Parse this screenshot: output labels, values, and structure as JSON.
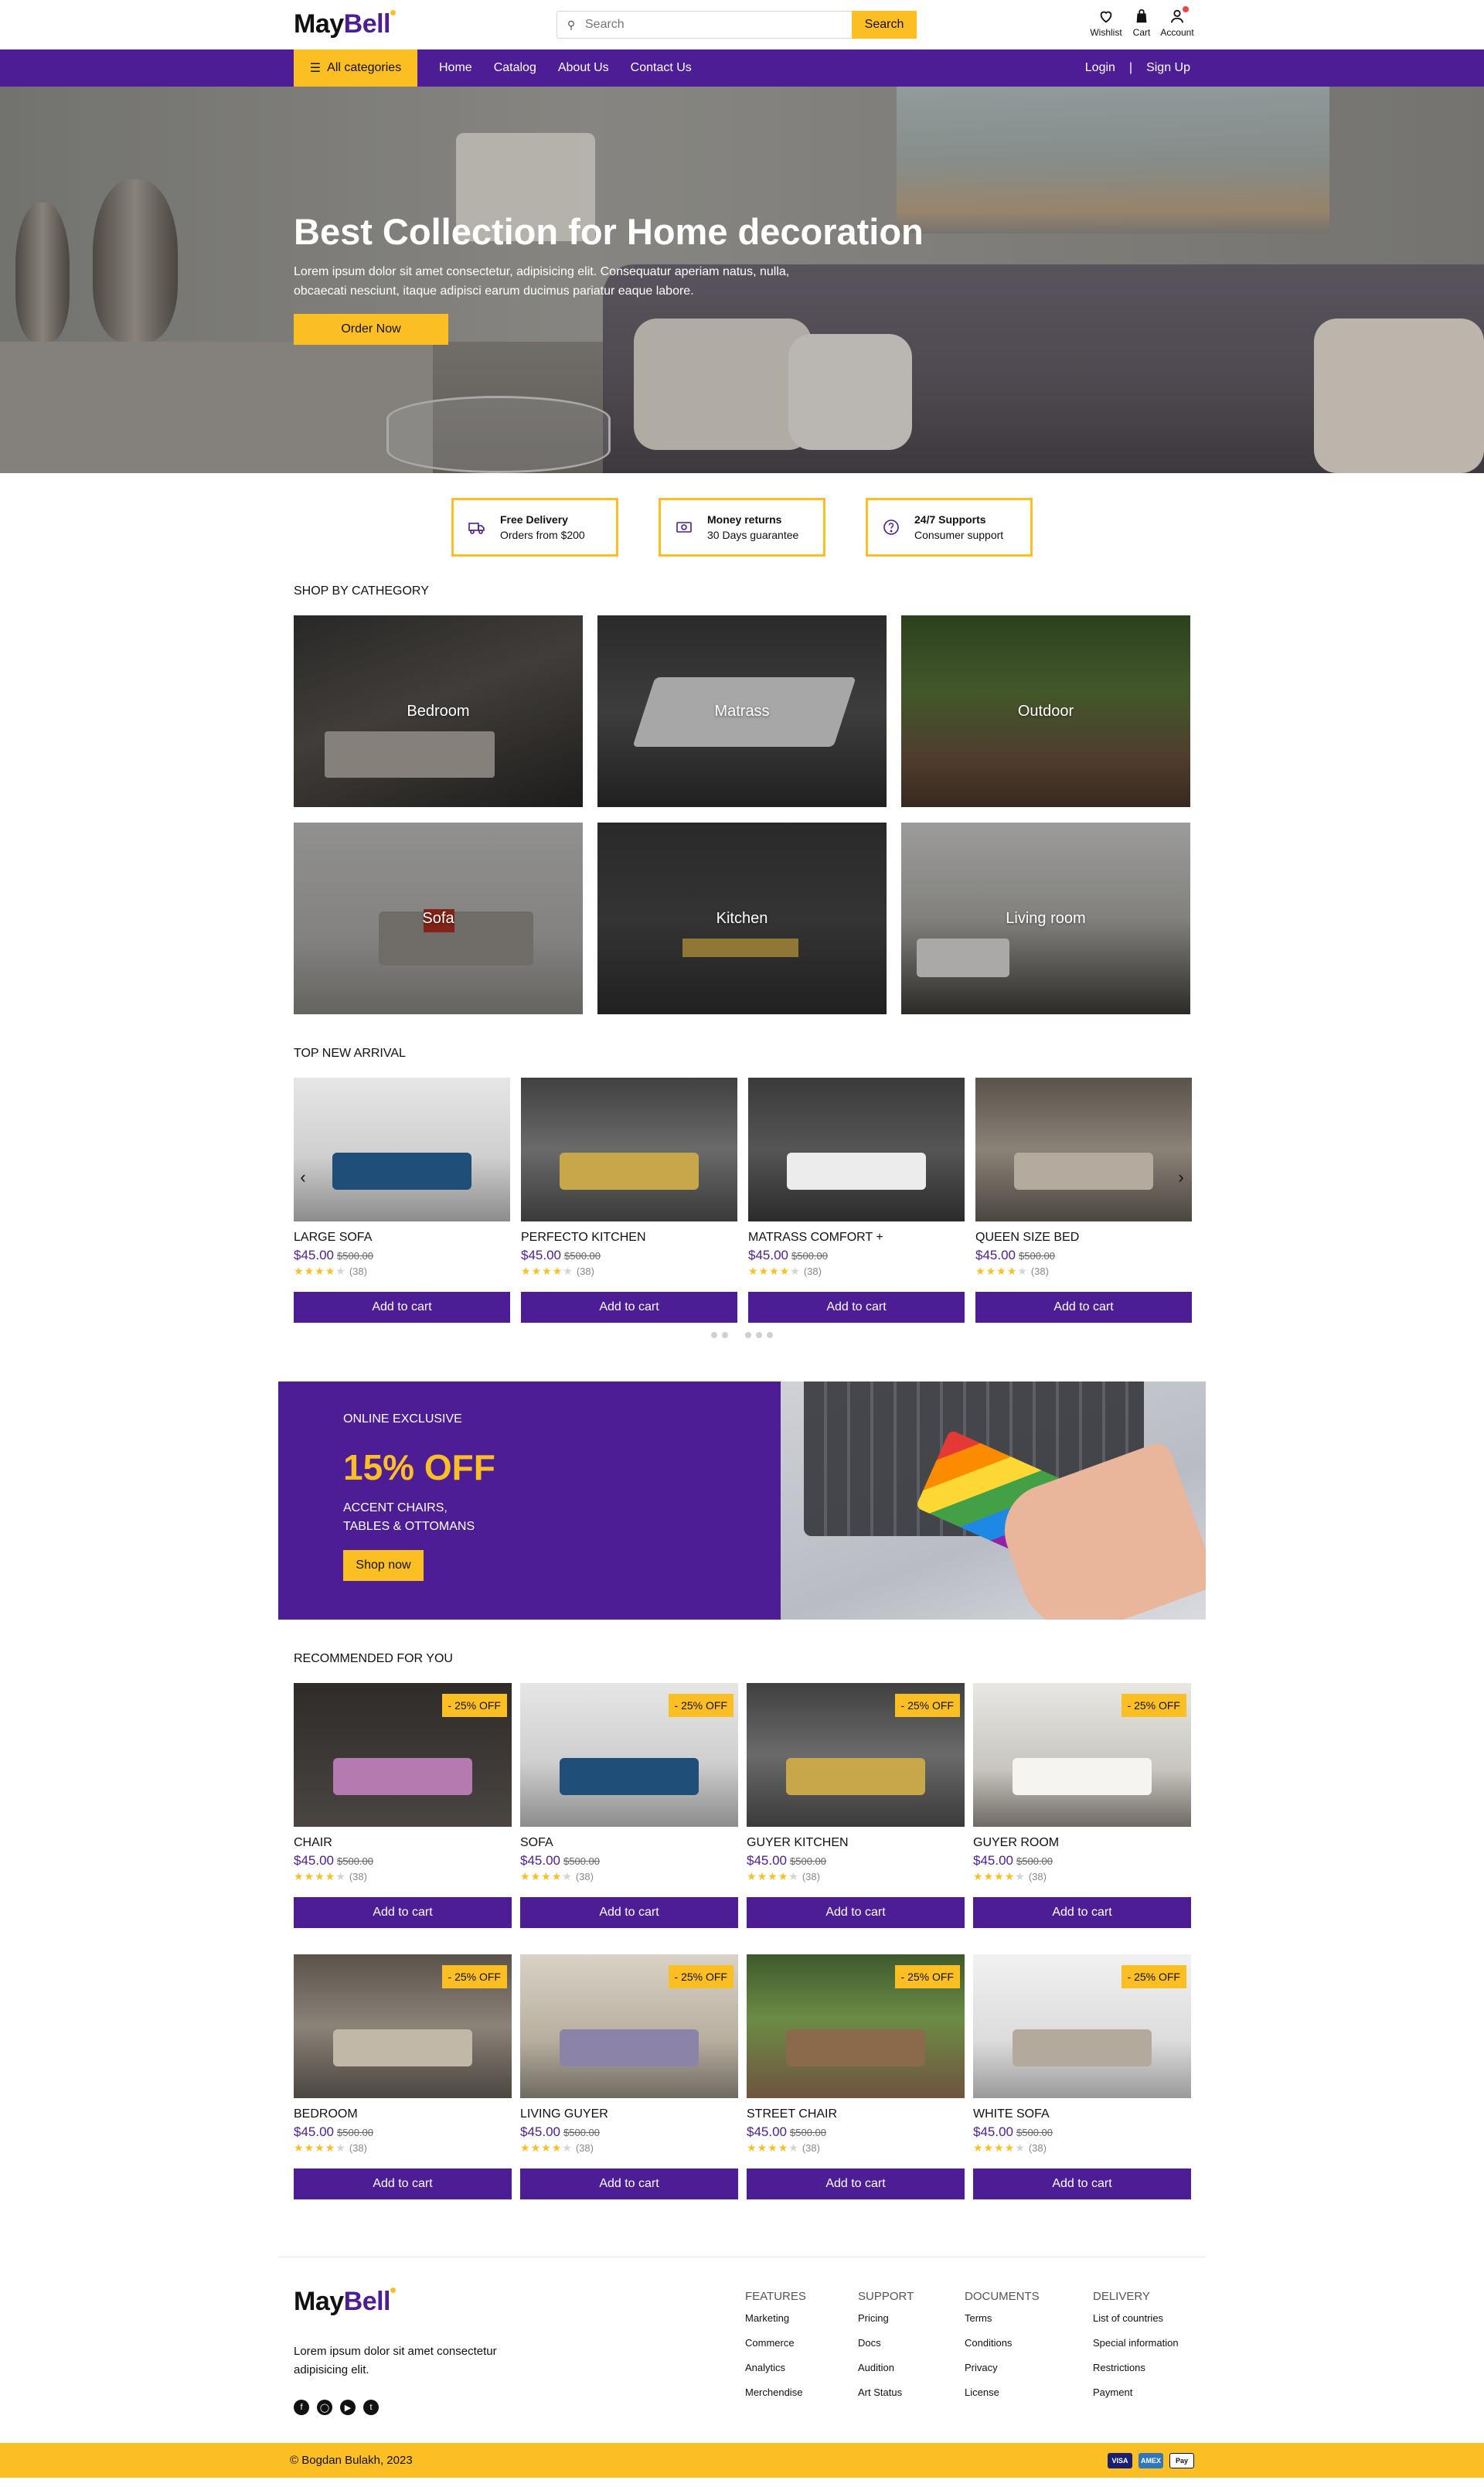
{
  "header": {
    "logo_main": "May",
    "logo_accent": "Bell",
    "search_placeholder": "Search",
    "search_button": "Search",
    "icons": [
      {
        "label": "Wishlist",
        "icon": "heart-icon"
      },
      {
        "label": "Cart",
        "icon": "bag-icon"
      },
      {
        "label": "Account",
        "icon": "user-icon"
      }
    ]
  },
  "nav": {
    "all_categories": "All categories",
    "links": [
      "Home",
      "Catalog",
      "About Us",
      "Contact Us"
    ],
    "login": "Login",
    "separator": "|",
    "signup": "Sign Up"
  },
  "hero": {
    "title": "Best Collection for Home decoration",
    "text": "Lorem ipsum dolor sit amet consectetur, adipisicing elit. Consequatur aperiam natus, nulla, obcaecati nesciunt, itaque adipisci earum ducimus pariatur eaque labore.",
    "button": "Order Now"
  },
  "features": [
    {
      "title": "Free Delivery",
      "subtitle": "Orders from $200",
      "icon": "truck-icon"
    },
    {
      "title": "Money returns",
      "subtitle": "30 Days guarantee",
      "icon": "money-icon"
    },
    {
      "title": "24/7 Supports",
      "subtitle": "Consumer support",
      "icon": "question-icon"
    }
  ],
  "categories": {
    "title": "SHOP BY CATHEGORY",
    "items": [
      "Bedroom",
      "Matrass",
      "Outdoor",
      "Sofa",
      "Kitchen",
      "Living room"
    ]
  },
  "new_arrival": {
    "title": "TOP NEW ARRIVAL",
    "products": [
      {
        "name": "LARGE SOFA",
        "price": "$45.00",
        "old_price": "$500.00",
        "rating": 4,
        "reviews": "(38)",
        "button": "Add to cart"
      },
      {
        "name": "PERFECTO KITCHEN",
        "price": "$45.00",
        "old_price": "$500.00",
        "rating": 4,
        "reviews": "(38)",
        "button": "Add to cart"
      },
      {
        "name": "MATRASS COMFORT +",
        "price": "$45.00",
        "old_price": "$500.00",
        "rating": 4,
        "reviews": "(38)",
        "button": "Add to cart"
      },
      {
        "name": "QUEEN SIZE BED",
        "price": "$45.00",
        "old_price": "$500.00",
        "rating": 4,
        "reviews": "(38)",
        "button": "Add to cart"
      }
    ],
    "carousel_prev": "‹",
    "carousel_next": "›"
  },
  "promo": {
    "tag": "ONLINE EXCLUSIVE",
    "discount": "15% OFF",
    "line1": "ACCENT CHAIRS,",
    "line2": "TABLES & OTTOMANS",
    "button": "Shop now"
  },
  "recommended": {
    "title": "RECOMMENDED FOR YOU",
    "badge": "- 25% OFF",
    "products": [
      {
        "name": "CHAIR",
        "price": "$45.00",
        "old_price": "$500.00",
        "rating": 4,
        "reviews": "(38)",
        "button": "Add to cart"
      },
      {
        "name": "SOFA",
        "price": "$45.00",
        "old_price": "$500.00",
        "rating": 4,
        "reviews": "(38)",
        "button": "Add to cart"
      },
      {
        "name": "GUYER KITCHEN",
        "price": "$45.00",
        "old_price": "$500.00",
        "rating": 4,
        "reviews": "(38)",
        "button": "Add to cart"
      },
      {
        "name": "GUYER ROOM",
        "price": "$45.00",
        "old_price": "$500.00",
        "rating": 4,
        "reviews": "(38)",
        "button": "Add to cart"
      },
      {
        "name": "BEDROOM",
        "price": "$45.00",
        "old_price": "$500.00",
        "rating": 4,
        "reviews": "(38)",
        "button": "Add to cart"
      },
      {
        "name": "LIVING GUYER",
        "price": "$45.00",
        "old_price": "$500.00",
        "rating": 4,
        "reviews": "(38)",
        "button": "Add to cart"
      },
      {
        "name": "STREET CHAIR",
        "price": "$45.00",
        "old_price": "$500.00",
        "rating": 4,
        "reviews": "(38)",
        "button": "Add to cart"
      },
      {
        "name": "WHITE SOFA",
        "price": "$45.00",
        "old_price": "$500.00",
        "rating": 4,
        "reviews": "(38)",
        "button": "Add to cart"
      }
    ]
  },
  "footer": {
    "logo_main": "May",
    "logo_accent": "Bell",
    "description": "Lorem ipsum dolor sit amet consectetur adipisicing elit.",
    "social": [
      "facebook-icon",
      "instagram-icon",
      "youtube-icon",
      "twitter-icon"
    ],
    "columns": [
      {
        "title": "FEATURES",
        "links": [
          "Marketing",
          "Commerce",
          "Analytics",
          "Merchendise"
        ]
      },
      {
        "title": "SUPPORT",
        "links": [
          "Pricing",
          "Docs",
          "Audition",
          "Art Status"
        ]
      },
      {
        "title": "DOCUMENTS",
        "links": [
          "Terms",
          "Conditions",
          "Privacy",
          "License"
        ]
      },
      {
        "title": "DELIVERY",
        "links": [
          "List of countries",
          "Special information",
          "Restrictions",
          "Payment"
        ]
      }
    ],
    "copyright": "© Bogdan Bulakh, 2023",
    "payment_cards": [
      "VISA",
      "AMEX",
      "Pay"
    ]
  },
  "colors": {
    "brand": "#4c1d95",
    "accent": "#fbbf24"
  }
}
